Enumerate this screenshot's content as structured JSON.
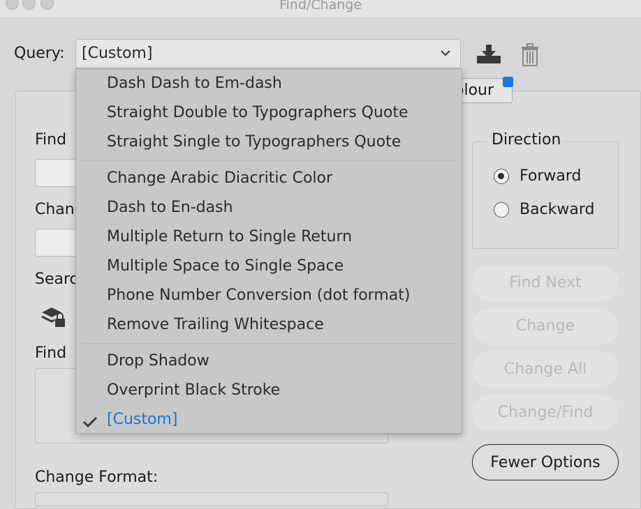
{
  "window": {
    "title": "Find/Change"
  },
  "query": {
    "label": "Query:",
    "value": "[Custom]"
  },
  "tabs": {
    "colour_partial": "olour"
  },
  "left_labels": {
    "find": "Find",
    "change": "Chan",
    "search": "Searc",
    "find_format": "Find",
    "change_format": "Change Format:"
  },
  "direction": {
    "title": "Direction",
    "options": [
      {
        "label": "Forward",
        "selected": true
      },
      {
        "label": "Backward",
        "selected": false
      }
    ]
  },
  "buttons": {
    "find_next": "Find Next",
    "change": "Change",
    "change_all": "Change All",
    "change_find": "Change/Find",
    "fewer_options": "Fewer Options"
  },
  "menu": {
    "groups": [
      [
        "Dash Dash to Em-dash",
        "Straight Double to Typographers Quote",
        "Straight Single to Typographers Quote"
      ],
      [
        "Change Arabic Diacritic Color",
        "Dash to En-dash",
        "Multiple Return to Single Return",
        "Multiple Space to Single Space",
        "Phone Number Conversion (dot format)",
        "Remove Trailing Whitespace"
      ],
      [
        "Drop Shadow",
        "Overprint Black Stroke",
        "[Custom]"
      ]
    ],
    "selected": "[Custom]"
  },
  "colors": {
    "accent": "#1a72d8",
    "badge": "#1b77e6"
  },
  "icons": [
    "save-query-icon",
    "trash-icon",
    "chevron-down-icon",
    "search-scope-icon",
    "checkmark-icon"
  ]
}
